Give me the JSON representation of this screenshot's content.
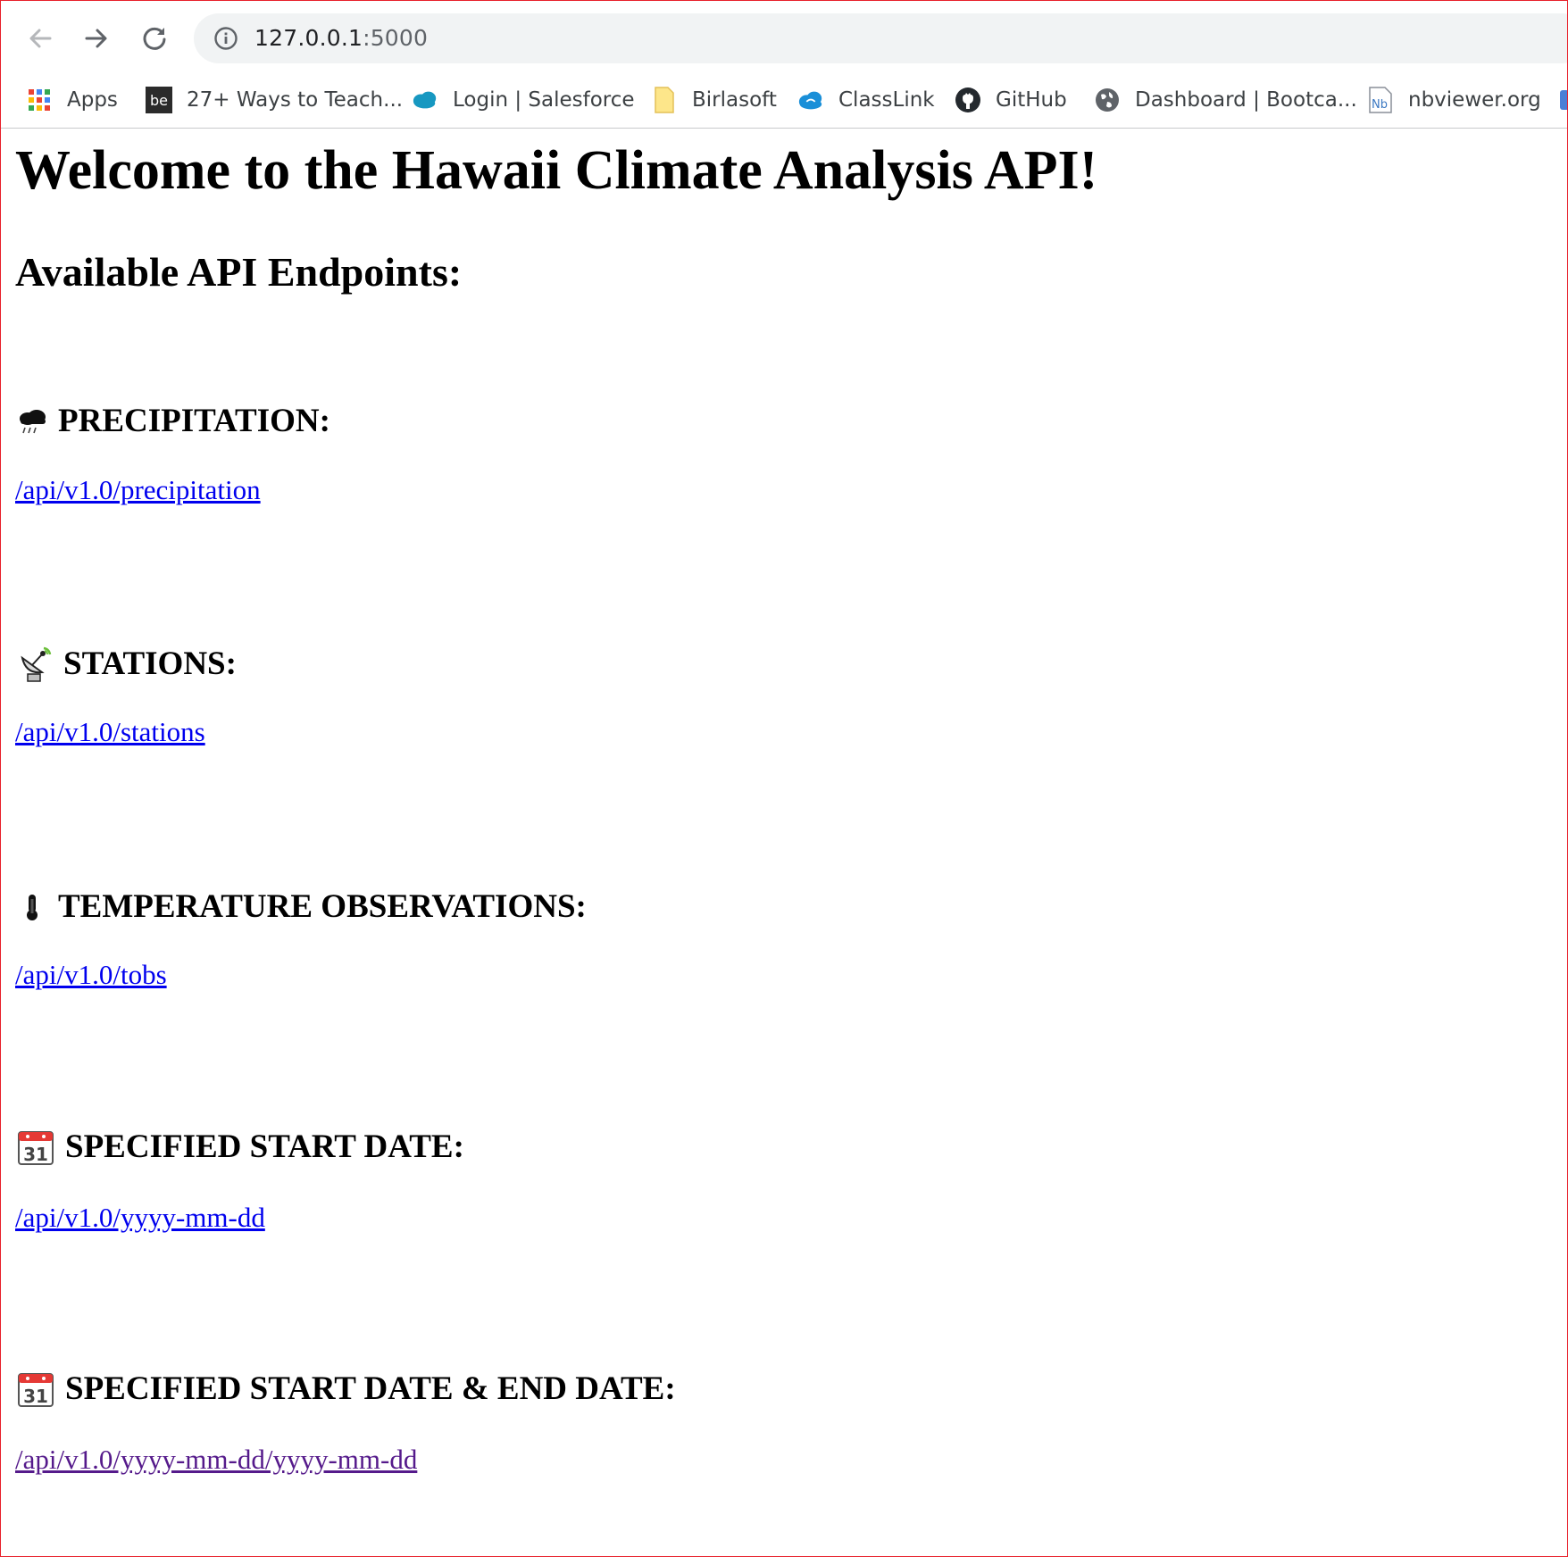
{
  "browser": {
    "url_host": "127.0.0.1",
    "url_port": ":5000",
    "bookmarks": [
      {
        "label": "Apps",
        "icon": "apps-grid-icon"
      },
      {
        "label": "27+ Ways to Teach...",
        "icon": "be-icon"
      },
      {
        "label": "Login | Salesforce",
        "icon": "salesforce-cloud-icon"
      },
      {
        "label": "Birlasoft",
        "icon": "folder-icon"
      },
      {
        "label": "ClassLink",
        "icon": "classlink-cloud-icon"
      },
      {
        "label": "GitHub",
        "icon": "github-icon"
      },
      {
        "label": "Dashboard | Bootca...",
        "icon": "globe-icon"
      },
      {
        "label": "nbviewer.org",
        "icon": "nb-icon"
      }
    ]
  },
  "page": {
    "title": "Welcome to the Hawaii Climate Analysis API!",
    "subtitle": "Available API Endpoints:",
    "sections": [
      {
        "heading": "PRECIPITATION:",
        "icon": "rain-cloud-icon",
        "endpoint": "/api/v1.0/precipitation"
      },
      {
        "heading": "STATIONS:",
        "icon": "satellite-dish-icon",
        "endpoint": "/api/v1.0/stations"
      },
      {
        "heading": "TEMPERATURE OBSERVATIONS:",
        "icon": "thermometer-icon",
        "endpoint": "/api/v1.0/tobs"
      },
      {
        "heading": "SPECIFIED START DATE:",
        "icon": "calendar-icon",
        "calendar_day": "31",
        "endpoint": "/api/v1.0/yyyy-mm-dd"
      },
      {
        "heading": "SPECIFIED START DATE & END DATE:",
        "icon": "calendar-icon",
        "calendar_day": "31",
        "endpoint": "/api/v1.0/yyyy-mm-dd/yyyy-mm-dd",
        "visited": true
      }
    ]
  },
  "colors": {
    "link": "#0000ee",
    "visited_link": "#551a8b",
    "frame_border": "#e8202a",
    "omnibox_bg": "#f1f3f4"
  }
}
